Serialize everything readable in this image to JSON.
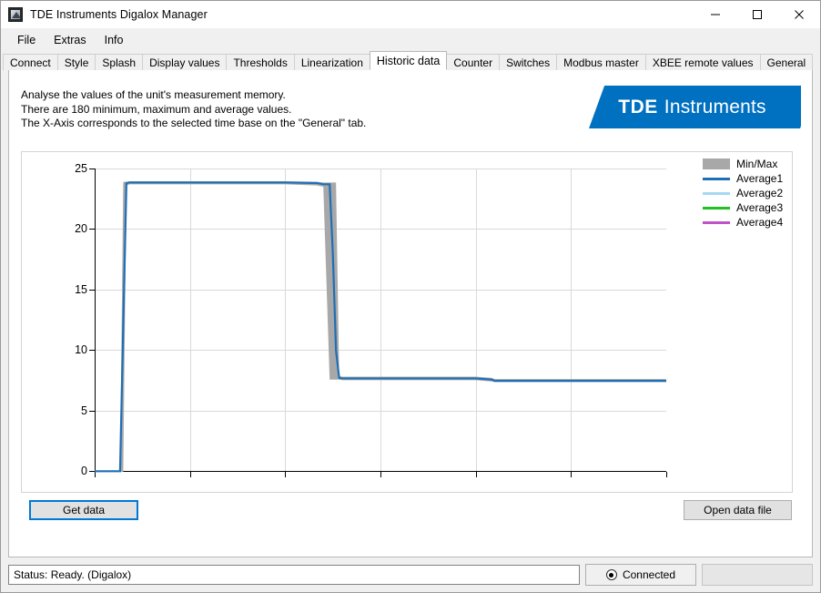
{
  "window": {
    "title": "TDE Instruments Digalox Manager",
    "icon": "app-image-icon",
    "buttons": {
      "minimize": "minimize-icon",
      "maximize": "maximize-icon",
      "close": "close-icon"
    }
  },
  "menubar": {
    "items": [
      "File",
      "Extras",
      "Info"
    ]
  },
  "tabs": [
    {
      "label": "Connect",
      "active": false
    },
    {
      "label": "Style",
      "active": false
    },
    {
      "label": "Splash",
      "active": false
    },
    {
      "label": "Display values",
      "active": false
    },
    {
      "label": "Thresholds",
      "active": false
    },
    {
      "label": "Linearization",
      "active": false
    },
    {
      "label": "Historic data",
      "active": true
    },
    {
      "label": "Counter",
      "active": false
    },
    {
      "label": "Switches",
      "active": false
    },
    {
      "label": "Modbus master",
      "active": false
    },
    {
      "label": "XBEE remote values",
      "active": false
    },
    {
      "label": "General",
      "active": false
    }
  ],
  "info": {
    "line1": "Analyse the values of the unit's measurement memory.",
    "line2": "There are 180 minimum, maximum and average values.",
    "line3": "The X-Axis corresponds to the selected time base on the \"General\" tab."
  },
  "logo": {
    "bold": "TDE",
    "light": "Instruments",
    "color": "#0070c0"
  },
  "buttons": {
    "get_data": "Get data",
    "open_data_file": "Open data file"
  },
  "statusbar": {
    "status_text": "Status: Ready. (Digalox)",
    "connection_label": "Connected",
    "connection_state": "connected"
  },
  "chart_data": {
    "type": "line",
    "title": "",
    "xlabel": "",
    "ylabel": "",
    "ylim": [
      0,
      25
    ],
    "yticks": [
      0,
      5,
      10,
      15,
      20,
      25
    ],
    "xlim": [
      0,
      180
    ],
    "xticks": [
      0,
      30,
      60,
      90,
      120,
      150,
      180
    ],
    "xtick_labels": [
      "",
      "",
      "",
      "",
      "",
      "",
      ""
    ],
    "grid": true,
    "legend_position": "top-right",
    "legend": [
      {
        "name": "Min/Max",
        "color": "#a8a8a8",
        "style": "band"
      },
      {
        "name": "Average1",
        "color": "#1f6fb5",
        "style": "line"
      },
      {
        "name": "Average2",
        "color": "#a5d8f3",
        "style": "line"
      },
      {
        "name": "Average3",
        "color": "#22c022",
        "style": "line"
      },
      {
        "name": "Average4",
        "color": "#c052c8",
        "style": "line"
      }
    ],
    "x": [
      0,
      8,
      9,
      10,
      11,
      60,
      70,
      72,
      74,
      75,
      76,
      77,
      78,
      120,
      125,
      126,
      180
    ],
    "series": [
      {
        "name": "Average1",
        "color": "#1f6fb5",
        "values": [
          0.05,
          0.05,
          12.0,
          23.8,
          23.85,
          23.85,
          23.8,
          23.7,
          23.7,
          18.0,
          10.0,
          7.75,
          7.7,
          7.7,
          7.6,
          7.5,
          7.5
        ]
      },
      {
        "name": "Min/Max",
        "color": "#a8a8a8",
        "min": [
          0.0,
          0.0,
          0.0,
          23.6,
          23.7,
          23.7,
          23.6,
          23.5,
          7.6,
          7.6,
          7.6,
          7.6,
          7.55,
          7.55,
          7.45,
          7.4,
          7.4
        ],
        "max": [
          0.1,
          0.1,
          23.9,
          23.9,
          23.95,
          23.95,
          23.9,
          23.85,
          23.85,
          23.85,
          23.85,
          7.9,
          7.85,
          7.85,
          7.75,
          7.65,
          7.65
        ]
      },
      {
        "name": "Average2",
        "color": "#a5d8f3",
        "values": []
      },
      {
        "name": "Average3",
        "color": "#22c022",
        "values": []
      },
      {
        "name": "Average4",
        "color": "#c052c8",
        "values": []
      }
    ]
  }
}
